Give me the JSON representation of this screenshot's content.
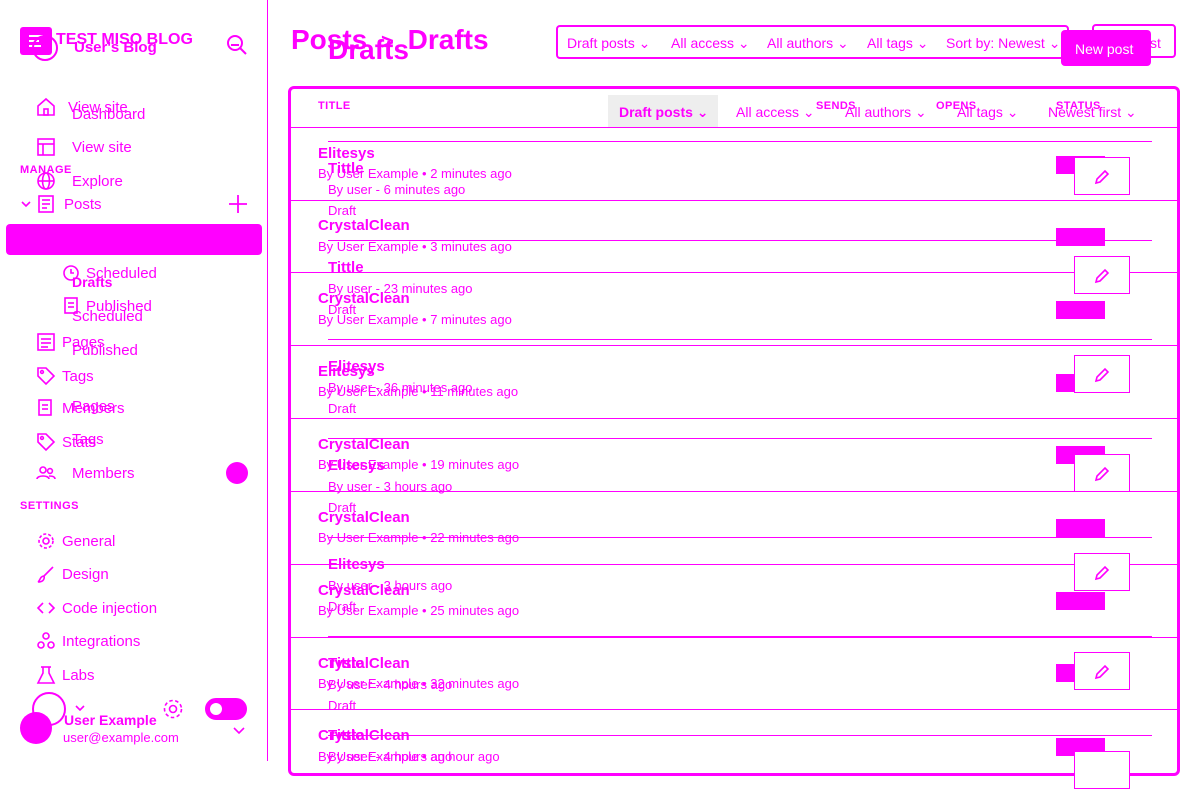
{
  "brand": {
    "title": "TEST MISO BLOG",
    "subtitle": "User's Blog"
  },
  "sidebar": {
    "items_top": [
      {
        "label": "View site",
        "icon": "home-icon"
      },
      {
        "label": "Dashboard",
        "icon": "dashboard-icon"
      },
      {
        "label": "View site",
        "icon": "layout-icon"
      },
      {
        "label": "Explore",
        "icon": "globe-icon"
      }
    ],
    "manage_label": "MANAGE",
    "posts_label": "Posts",
    "posts_sub": [
      "Drafts",
      "Scheduled",
      "Published"
    ],
    "posts_sub_overlay": [
      "Scheduled",
      "Published"
    ],
    "pages_label": "Pages",
    "pages_label_2": "Pages",
    "tags_label": "Tags",
    "tags_label_2": "Tags",
    "members_label": "Members",
    "members_label_2": "Members",
    "stats_label": "Stats",
    "settings_label": "SETTINGS",
    "settings_items": [
      "General",
      "Design",
      "Code injection",
      "Integrations",
      "Labs"
    ]
  },
  "user": {
    "name": "User Example",
    "email": "user@example.com"
  },
  "header": {
    "title": "Posts",
    "separator": ">",
    "crumb": "Drafts",
    "title_overlay": "Drafts",
    "new_post_label": "New post",
    "new_post_label_2": "st",
    "filters": [
      "Draft posts",
      "All access",
      "All authors",
      "All tags",
      "Sort by: Newest"
    ]
  },
  "table": {
    "columns": [
      "TITLE",
      "SENDS",
      "OPENS",
      "STATUS"
    ],
    "inner_filters": [
      "Draft posts",
      "All access",
      "All authors",
      "All tags",
      "Newest first"
    ],
    "rows_a": [
      {
        "title": "Elitesys",
        "meta": "By User Example • 2 minutes ago"
      },
      {
        "title": "CrystalClean",
        "meta": "By User Example • 3 minutes ago"
      },
      {
        "title": "CrystalClean",
        "meta": "By User Example • 7 minutes ago"
      },
      {
        "title": "Elitesys",
        "meta": "By User Example • 11 minutes ago"
      },
      {
        "title": "CrystalClean",
        "meta": "By User Example • 19 minutes ago"
      },
      {
        "title": "CrystalClean",
        "meta": "By User Example • 22 minutes ago"
      },
      {
        "title": "CrystalClean",
        "meta": "By User Example • 25 minutes ago"
      },
      {
        "title": "CrystalClean",
        "meta": "By User Example • 32 minutes ago"
      },
      {
        "title": "CrystalClean",
        "meta": "By User Example • an hour ago"
      }
    ],
    "rows_b": [
      {
        "title": "Tittle",
        "meta": "By user - 6 minutes ago",
        "status": "Draft"
      },
      {
        "title": "Tittle",
        "meta": "By user - 23 minutes ago",
        "status": "Draft"
      },
      {
        "title": "Elitesys",
        "meta": "By user - 36 minutes ago",
        "status": "Draft"
      },
      {
        "title": "Elitesys",
        "meta": "By user - 3 hours ago",
        "status": "Draft"
      },
      {
        "title": "Elitesys",
        "meta": "By user - 3 hours ago",
        "status": "Draft"
      },
      {
        "title": "Tittle",
        "meta": "By user - 4 hours ago",
        "status": "Draft"
      },
      {
        "title": "Tittle",
        "meta": "By user - 4 hours ago",
        "status": ""
      }
    ]
  },
  "colors": {
    "accent": "#ff00ff",
    "background": "#ffffff",
    "chip": "#eeeeee"
  }
}
